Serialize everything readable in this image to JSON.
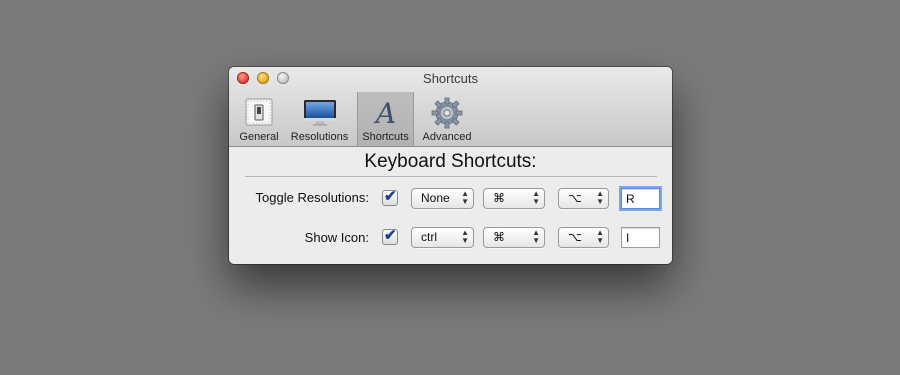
{
  "window": {
    "title": "Shortcuts"
  },
  "tabs": [
    {
      "label": "General",
      "icon": "general-switch-icon"
    },
    {
      "label": "Resolutions",
      "icon": "monitor-icon"
    },
    {
      "label": "Shortcuts",
      "icon": "letter-a-icon",
      "selected": true
    },
    {
      "label": "Advanced",
      "icon": "gear-icon"
    }
  ],
  "content": {
    "heading": "Keyboard Shortcuts:",
    "rows": [
      {
        "label": "Toggle Resolutions:",
        "enabled": true,
        "modifier1": "None",
        "modifier2": "⌘",
        "modifier3": "⌥",
        "key": "R"
      },
      {
        "label": "Show Icon:",
        "enabled": true,
        "modifier1": "ctrl",
        "modifier2": "⌘",
        "modifier3": "⌥",
        "key": "I"
      }
    ]
  },
  "colors": {
    "background": "#7b7b7b",
    "check": "#1c3f8f",
    "focus_ring": "#7aa6e6"
  }
}
